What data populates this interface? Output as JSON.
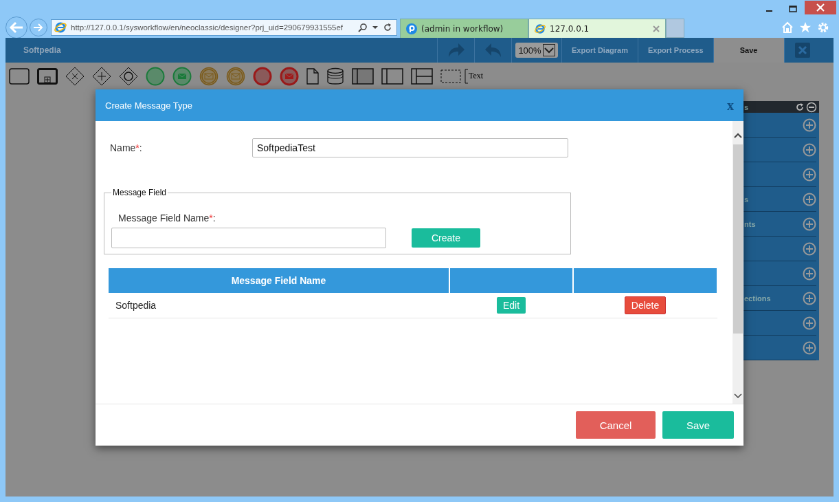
{
  "browser": {
    "address": "http://127.0.0.1/sysworkflow/en/neoclassic/designer?prj_uid=290679931555ef",
    "tabs": [
      {
        "label": "(admin in workflow)",
        "selected": false
      },
      {
        "label": "127.0.0.1",
        "selected": true
      }
    ]
  },
  "app": {
    "title": "Softpedia",
    "zoom": "100%",
    "actions": [
      "Export Diagram",
      "Export Process"
    ],
    "save": "Save",
    "toolbar_text": "Text"
  },
  "panel": {
    "header": "s",
    "items": [
      {
        "kind": "unlabeled"
      },
      {
        "kind": "unlabeled"
      },
      {
        "kind": "unlabeled"
      },
      {
        "kind": "labeled",
        "label": "s"
      },
      {
        "kind": "labeled",
        "label": "nts"
      },
      {
        "kind": "unlabeled"
      },
      {
        "kind": "unlabeled"
      },
      {
        "kind": "labeled",
        "label": "ections"
      },
      {
        "kind": "unlabeled"
      },
      {
        "kind": "unlabeled"
      }
    ]
  },
  "dialog": {
    "title": "Create Message Type",
    "close": "x",
    "name_label": "Name",
    "required": "*",
    "label_suffix": ":",
    "name_value": "SoftpediaTest",
    "fieldset_legend": "Message Field",
    "field_label": "Message Field Name",
    "create": "Create",
    "table": {
      "columns": [
        "Message Field Name",
        "",
        ""
      ],
      "rows": [
        {
          "name": "Softpedia",
          "edit": "Edit",
          "delete": "Delete"
        }
      ]
    },
    "buttons": {
      "cancel": "Cancel",
      "save": "Save"
    }
  }
}
